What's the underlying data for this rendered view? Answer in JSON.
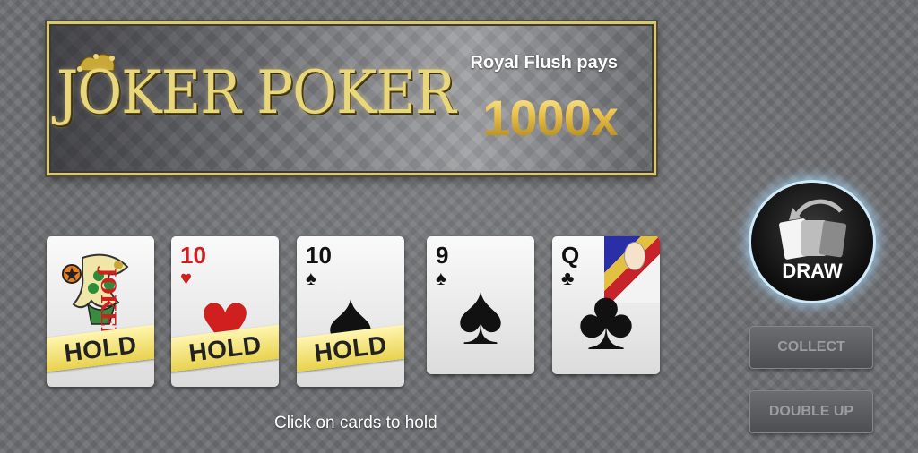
{
  "banner": {
    "logo_text": "JOKER POKER",
    "pays_label": "Royal Flush pays",
    "pays_value": "1000x"
  },
  "cards": [
    {
      "name": "joker",
      "rank": "",
      "suit": "",
      "color": "#cf1f1f",
      "held": true,
      "hold_label": "HOLD",
      "joker_letters": "JOKER"
    },
    {
      "name": "ten-of-hearts",
      "rank": "10",
      "suit": "♥",
      "color": "#cf1f1f",
      "held": true,
      "hold_label": "HOLD"
    },
    {
      "name": "ten-of-spades",
      "rank": "10",
      "suit": "♠",
      "color": "#111111",
      "held": true,
      "hold_label": "HOLD"
    },
    {
      "name": "nine-of-spades",
      "rank": "9",
      "suit": "♠",
      "color": "#111111",
      "held": false
    },
    {
      "name": "queen-of-clubs",
      "rank": "Q",
      "suit": "♣",
      "color": "#111111",
      "held": false
    }
  ],
  "instruction": "Click on cards to hold",
  "buttons": {
    "draw": "DRAW",
    "collect": "COLLECT",
    "double_up": "DOUBLE UP"
  },
  "colors": {
    "gold": "#e8d77c",
    "hold_yellow": "#e8d24e",
    "draw_glow": "#cfe9f7"
  }
}
